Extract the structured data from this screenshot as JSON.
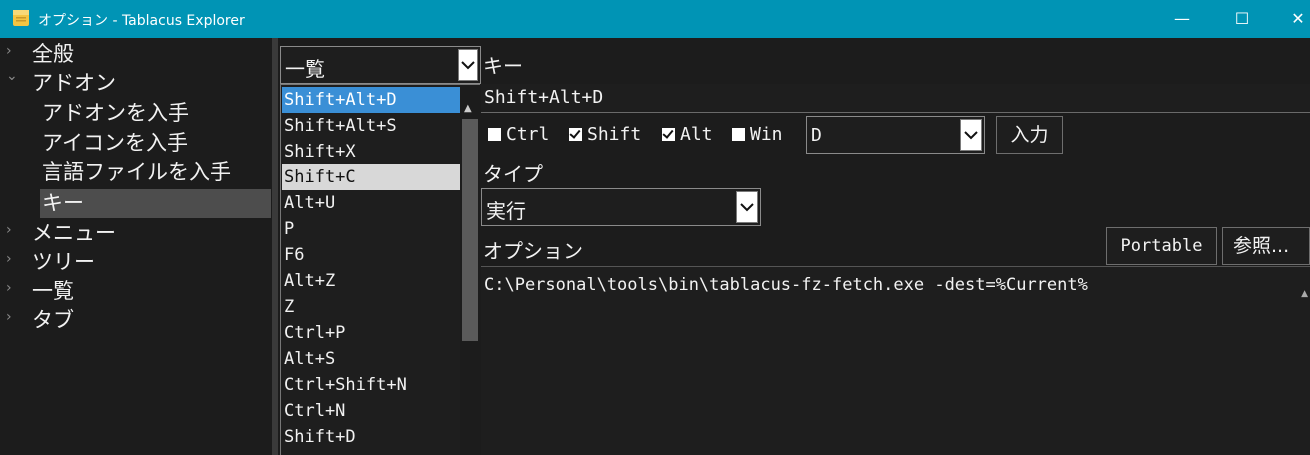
{
  "window": {
    "title": "オプション - Tablacus Explorer",
    "minimize_glyph": "—",
    "maximize_glyph": "☐",
    "close_glyph": "✕",
    "accent": "#0094b5"
  },
  "tree": {
    "items": [
      {
        "label": "全般",
        "chevron": "›"
      },
      {
        "label": "アドオン",
        "chevron": "⌄"
      },
      {
        "label": "アドオンを入手"
      },
      {
        "label": "アイコンを入手"
      },
      {
        "label": "言語ファイルを入手"
      },
      {
        "label": "キー"
      },
      {
        "label": "メニュー",
        "chevron": "›"
      },
      {
        "label": "ツリー",
        "chevron": "›"
      },
      {
        "label": "一覧",
        "chevron": "›"
      },
      {
        "label": "タブ",
        "chevron": "›"
      }
    ]
  },
  "keys": {
    "category_select": "一覧",
    "list": [
      "Shift+Alt+D",
      "Shift+Alt+S",
      "Shift+X",
      "Shift+C",
      "Alt+U",
      "P",
      "F6",
      "Alt+Z",
      "Z",
      "Ctrl+P",
      "Alt+S",
      "Ctrl+Shift+N",
      "Ctrl+N",
      "Shift+D"
    ],
    "selected_color": "#3a8fd6"
  },
  "editor": {
    "key_label": "キー",
    "key_value": "Shift+Alt+D",
    "modifiers": {
      "ctrl": {
        "label": "Ctrl",
        "checked": false
      },
      "shift": {
        "label": "Shift",
        "checked": true
      },
      "alt": {
        "label": "Alt",
        "checked": true
      },
      "win": {
        "label": "Win",
        "checked": false
      }
    },
    "key_select": "D",
    "input_button": "入力",
    "type_label": "タイプ",
    "type_select": "実行",
    "option_label": "オプション",
    "portable_button": "Portable",
    "browse_button": "参照...",
    "option_value": "C:\\Personal\\tools\\bin\\tablacus-fz-fetch.exe -dest=%Current%"
  }
}
